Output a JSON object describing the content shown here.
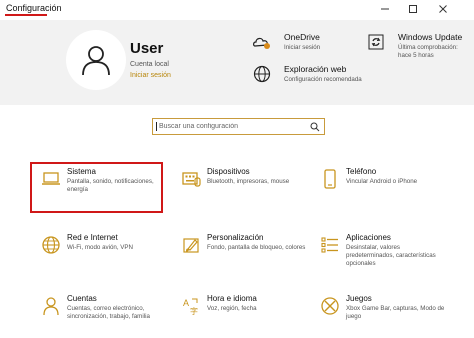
{
  "window": {
    "title": "Configuración",
    "controls": [
      "minimize",
      "maximize",
      "close"
    ]
  },
  "account": {
    "name": "User",
    "type": "Cuenta local",
    "signin_link": "Iniciar sesión"
  },
  "services": [
    {
      "title": "OneDrive",
      "desc": "Iniciar sesión",
      "icon": "onedrive-cloud-icon"
    },
    {
      "title": "Windows Update",
      "desc": "Última comprobación: hace 5 horas",
      "icon": "sync-icon"
    },
    {
      "title": "Exploración web",
      "desc": "Configuración recomendada",
      "icon": "globe-icon"
    }
  ],
  "search": {
    "placeholder": "Buscar una configuración"
  },
  "categories": [
    {
      "title": "Sistema",
      "desc": "Pantalla, sonido, notificaciones, energía",
      "icon": "laptop-icon"
    },
    {
      "title": "Dispositivos",
      "desc": "Bluetooth, impresoras, mouse",
      "icon": "keyboard-icon"
    },
    {
      "title": "Teléfono",
      "desc": "Vincular Android o iPhone",
      "icon": "phone-icon"
    },
    {
      "title": "Red e Internet",
      "desc": "Wi-Fi, modo avión, VPN",
      "icon": "globe-icon"
    },
    {
      "title": "Personalización",
      "desc": "Fondo, pantalla de bloqueo, colores",
      "icon": "paint-brush-icon"
    },
    {
      "title": "Aplicaciones",
      "desc": "Desinstalar, valores predeterminados, características opcionales",
      "icon": "apps-list-icon"
    },
    {
      "title": "Cuentas",
      "desc": "Cuentas, correo electrónico, sincronización, trabajo, familia",
      "icon": "person-icon"
    },
    {
      "title": "Hora e idioma",
      "desc": "Voz, región, fecha",
      "icon": "time-language-icon"
    },
    {
      "title": "Juegos",
      "desc": "Xbox Game Bar, capturas, Modo de juego",
      "icon": "xbox-icon"
    }
  ],
  "colors": {
    "accent": "#c8951e",
    "highlight": "#d01818",
    "hero_bg": "#f2f2f2"
  }
}
